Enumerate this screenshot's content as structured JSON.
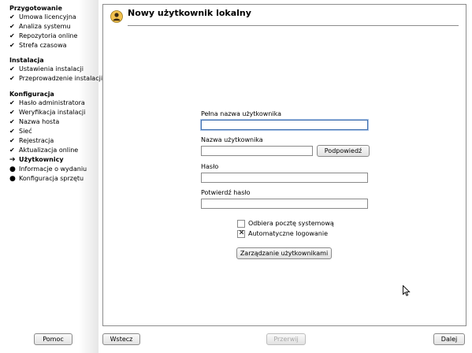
{
  "title": "Nowy użytkownik lokalny",
  "sidebar": {
    "sections": [
      {
        "title": "Przygotowanie",
        "steps": [
          {
            "label": "Umowa licencyjna",
            "state": "done"
          },
          {
            "label": "Analiza systemu",
            "state": "done"
          },
          {
            "label": "Repozytoria online",
            "state": "done"
          },
          {
            "label": "Strefa czasowa",
            "state": "done"
          }
        ]
      },
      {
        "title": "Instalacja",
        "steps": [
          {
            "label": "Ustawienia instalacji",
            "state": "done"
          },
          {
            "label": "Przeprowadzenie instalacji",
            "state": "done"
          }
        ]
      },
      {
        "title": "Konfiguracja",
        "steps": [
          {
            "label": "Hasło administratora",
            "state": "done"
          },
          {
            "label": "Weryfikacja instalacji",
            "state": "done"
          },
          {
            "label": "Nazwa hosta",
            "state": "done"
          },
          {
            "label": "Sieć",
            "state": "done"
          },
          {
            "label": "Rejestracja",
            "state": "done"
          },
          {
            "label": "Aktualizacja online",
            "state": "done"
          },
          {
            "label": "Użytkownicy",
            "state": "current"
          },
          {
            "label": "Informacje o wydaniu",
            "state": "pending"
          },
          {
            "label": "Konfiguracja sprzętu",
            "state": "pending"
          }
        ]
      }
    ]
  },
  "form": {
    "full_name_label": "Pełna nazwa użytkownika",
    "full_name_value": "",
    "username_label": "Nazwa użytkownika",
    "username_value": "",
    "suggest_button": "Podpowiedź",
    "password_label": "Hasło",
    "password_value": "",
    "confirm_label": "Potwierdź hasło",
    "confirm_value": "",
    "receive_mail_label": "Odbiera pocztę systemową",
    "receive_mail_checked": false,
    "autologin_label": "Automatyczne logowanie",
    "autologin_checked": true,
    "manage_users_button": "Zarządzanie użytkownikami"
  },
  "buttons": {
    "help": "Pomoc",
    "back": "Wstecz",
    "abort": "Przerwij",
    "next": "Dalej"
  },
  "icons": {
    "step_done": "checkmark-icon",
    "step_current": "arrow-right-icon",
    "step_pending": "bullet-icon",
    "header": "user-icon"
  }
}
